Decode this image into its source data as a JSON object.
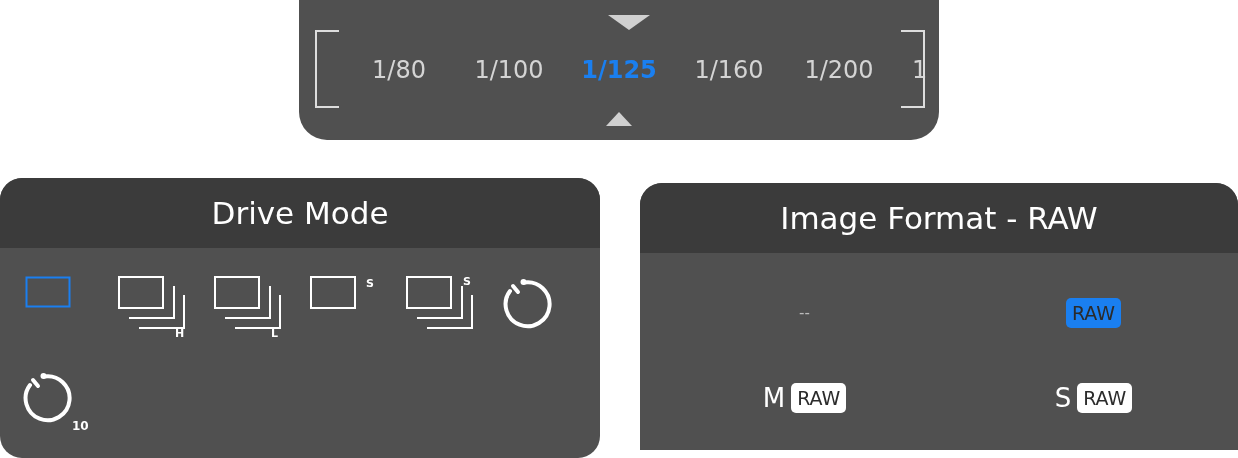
{
  "shutter_speed": {
    "values": [
      {
        "label": "1/80",
        "selected": false
      },
      {
        "label": "1/100",
        "selected": false
      },
      {
        "label": "1/125",
        "selected": true
      },
      {
        "label": "1/160",
        "selected": false
      },
      {
        "label": "1/200",
        "selected": false
      },
      {
        "label": "1",
        "selected": false
      }
    ]
  },
  "drive_mode": {
    "title": "Drive Mode",
    "options": [
      {
        "kind": "single",
        "selected": true
      },
      {
        "kind": "continuous",
        "label": "H",
        "selected": false
      },
      {
        "kind": "continuous",
        "label": "L",
        "selected": false
      },
      {
        "kind": "silent",
        "label": "S",
        "selected": false
      },
      {
        "kind": "silent-continuous",
        "label": "S",
        "selected": false
      },
      {
        "kind": "timer",
        "selected": false
      },
      {
        "kind": "timer",
        "label": "10",
        "selected": false
      }
    ]
  },
  "image_format": {
    "title": "Image Format - RAW",
    "options": [
      {
        "kind": "plain",
        "label": "--",
        "selected": false
      },
      {
        "kind": "badge",
        "label": "RAW",
        "selected": true
      },
      {
        "kind": "badge",
        "prefix": "M",
        "label": "RAW",
        "selected": false
      },
      {
        "kind": "badge",
        "prefix": "S",
        "label": "RAW",
        "selected": false
      }
    ]
  }
}
